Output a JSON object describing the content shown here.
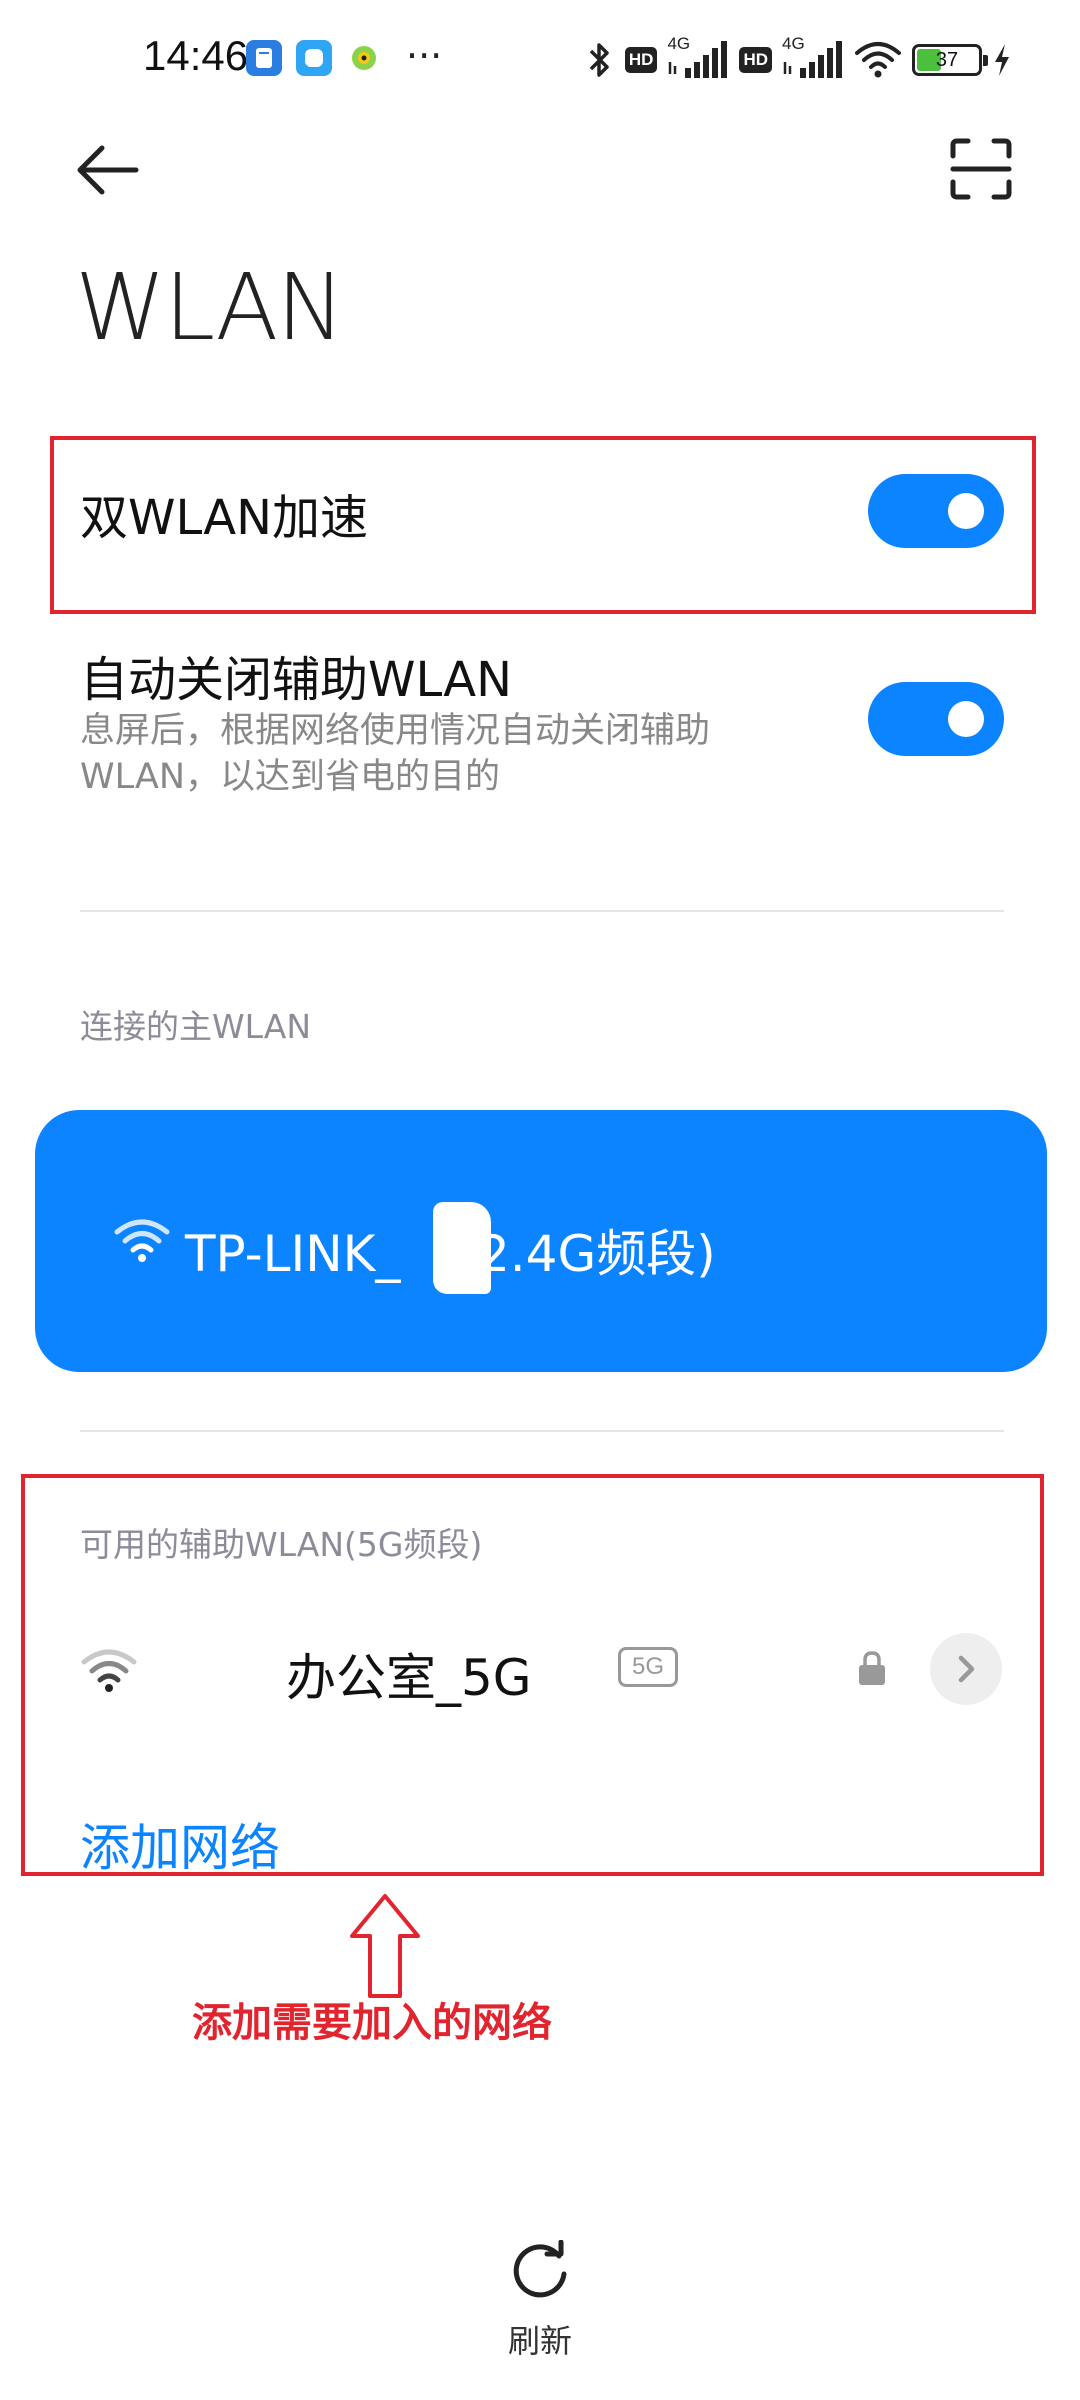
{
  "status_bar": {
    "time": "14:46",
    "more": "···",
    "hd1": "HD",
    "net1": "4G",
    "hd2": "HD",
    "net2": "4G",
    "battery": "37"
  },
  "header": {
    "title": "WLAN"
  },
  "settings": {
    "dual_wlan": {
      "title": "双WLAN加速",
      "enabled": true
    },
    "auto_close": {
      "title": "自动关闭辅助WLAN",
      "description": "息屏后，根据网络使用情况自动关闭辅助WLAN，以达到省电的目的",
      "enabled": true
    }
  },
  "primary_section": {
    "label": "连接的主WLAN",
    "network_name": "TP-LINK_",
    "network_band": "(2.4G频段)"
  },
  "secondary_section": {
    "label": "可用的辅助WLAN(5G频段)",
    "networks": [
      {
        "name": "办公室_5G",
        "badge": "5G"
      }
    ],
    "add_network": "添加网络"
  },
  "annotation": {
    "text": "添加需要加入的网络"
  },
  "footer": {
    "refresh_label": "刷新"
  },
  "colors": {
    "accent": "#0d84ff",
    "annotation_red": "#e1242e"
  }
}
